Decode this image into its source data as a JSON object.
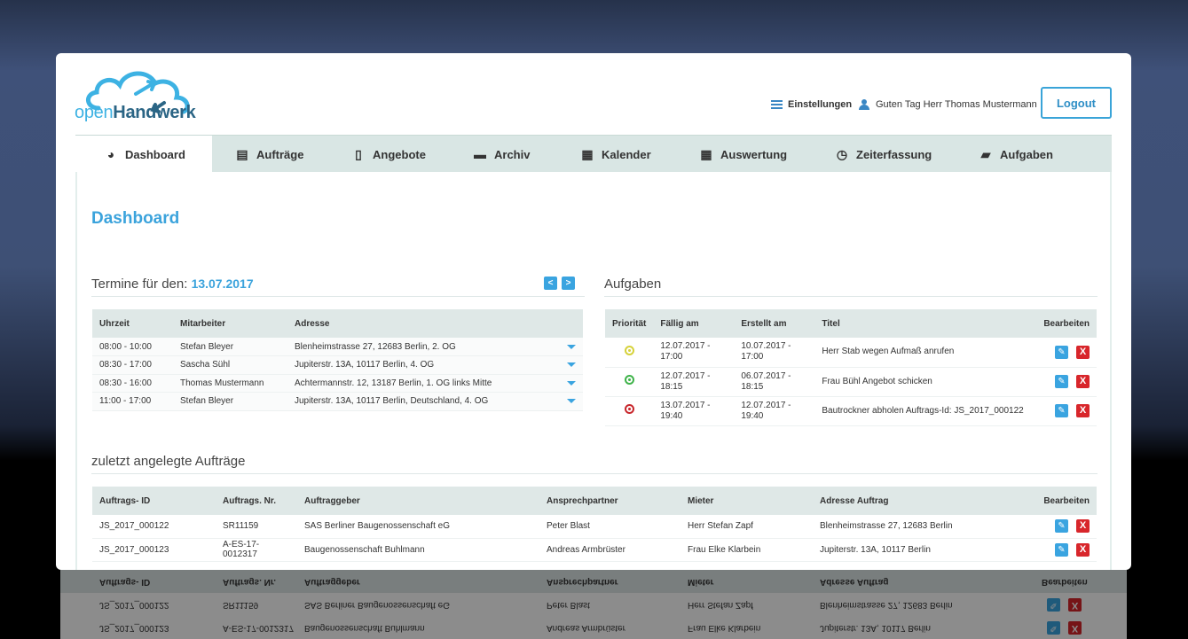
{
  "brand": {
    "open": "open",
    "rest": "Handwerk"
  },
  "header": {
    "settings": "Einstellungen",
    "greeting": "Guten Tag Herr Thomas Mustermann",
    "logout": "Logout"
  },
  "nav": {
    "tabs": [
      {
        "label": "Dashboard",
        "icon": "dashboard-icon"
      },
      {
        "label": "Aufträge",
        "icon": "document-list-icon"
      },
      {
        "label": "Angebote",
        "icon": "document-icon"
      },
      {
        "label": "Archiv",
        "icon": "archive-icon"
      },
      {
        "label": "Kalender",
        "icon": "calendar-icon"
      },
      {
        "label": "Auswertung",
        "icon": "grid-table-icon"
      },
      {
        "label": "Zeiterfassung",
        "icon": "clock-icon"
      },
      {
        "label": "Aufgaben",
        "icon": "book-icon"
      }
    ]
  },
  "page": {
    "title": "Dashboard"
  },
  "termine": {
    "title": "Termine für den:",
    "date": "13.07.2017",
    "prev": "<",
    "next": ">",
    "headers": [
      "Uhrzeit",
      "Mitarbeiter",
      "Adresse"
    ],
    "rows": [
      {
        "time": "08:00 - 10:00",
        "employee": "Stefan Bleyer",
        "address": "Blenheimstrasse 27, 12683 Berlin, 2. OG"
      },
      {
        "time": "08:30 - 17:00",
        "employee": "Sascha Sühl",
        "address": "Jupiterstr. 13A, 10117 Berlin, 4. OG"
      },
      {
        "time": "08:30 - 16:00",
        "employee": "Thomas Mustermann",
        "address": "Achtermannstr. 12, 13187 Berlin, 1. OG links Mitte"
      },
      {
        "time": "11:00 - 17:00",
        "employee": "Stefan Bleyer",
        "address": "Jupiterstr. 13A, 10117 Berlin, Deutschland, 4. OG"
      }
    ]
  },
  "aufgaben": {
    "title": "Aufgaben",
    "headers": [
      "Priorität",
      "Fällig am",
      "Erstellt am",
      "Titel",
      "Bearbeiten"
    ],
    "rows": [
      {
        "priority_color": "#d6d23a",
        "due_date": "12.07.2017 -",
        "due_time": "17:00",
        "created_date": "10.07.2017 -",
        "created_time": "17:00",
        "title": "Herr Stab wegen Aufmaß anrufen"
      },
      {
        "priority_color": "#3fb34a",
        "due_date": "12.07.2017 -",
        "due_time": "18:15",
        "created_date": "06.07.2017 -",
        "created_time": "18:15",
        "title": "Frau Bühl Angebot schicken"
      },
      {
        "priority_color": "#c8262b",
        "due_date": "13.07.2017 -",
        "due_time": "19:40",
        "created_date": "12.07.2017 -",
        "created_time": "19:40",
        "title": "Bautrockner abholen Auftrags-Id: JS_2017_000122"
      }
    ]
  },
  "auftraege": {
    "title": "zuletzt angelegte Aufträge",
    "headers": [
      "Auftrags- ID",
      "Auftrags. Nr.",
      "Auftraggeber",
      "Ansprechpartner",
      "Mieter",
      "Adresse Auftrag",
      "Bearbeiten"
    ],
    "rows": [
      {
        "id": "JS_2017_000122",
        "nr": "SR11159",
        "client": "SAS Berliner Baugenossenschaft eG",
        "contact": "Peter Blast",
        "tenant": "Herr Stefan Zapf",
        "address": "Blenheimstrasse 27, 12683 Berlin"
      },
      {
        "id": "JS_2017_000123",
        "nr": "A-ES-17-0012317",
        "client": "Baugenossenschaft Buhlmann",
        "contact": "Andreas Armbrüster",
        "tenant": "Frau Elke Klarbein",
        "address": "Jupiterstr. 13A, 10117 Berlin"
      }
    ]
  },
  "actions": {
    "edit": "✎",
    "delete": "X"
  },
  "colors": {
    "accent": "#3ba3dc",
    "nav_bg": "#d9e6e4",
    "delete": "#d8262b"
  }
}
